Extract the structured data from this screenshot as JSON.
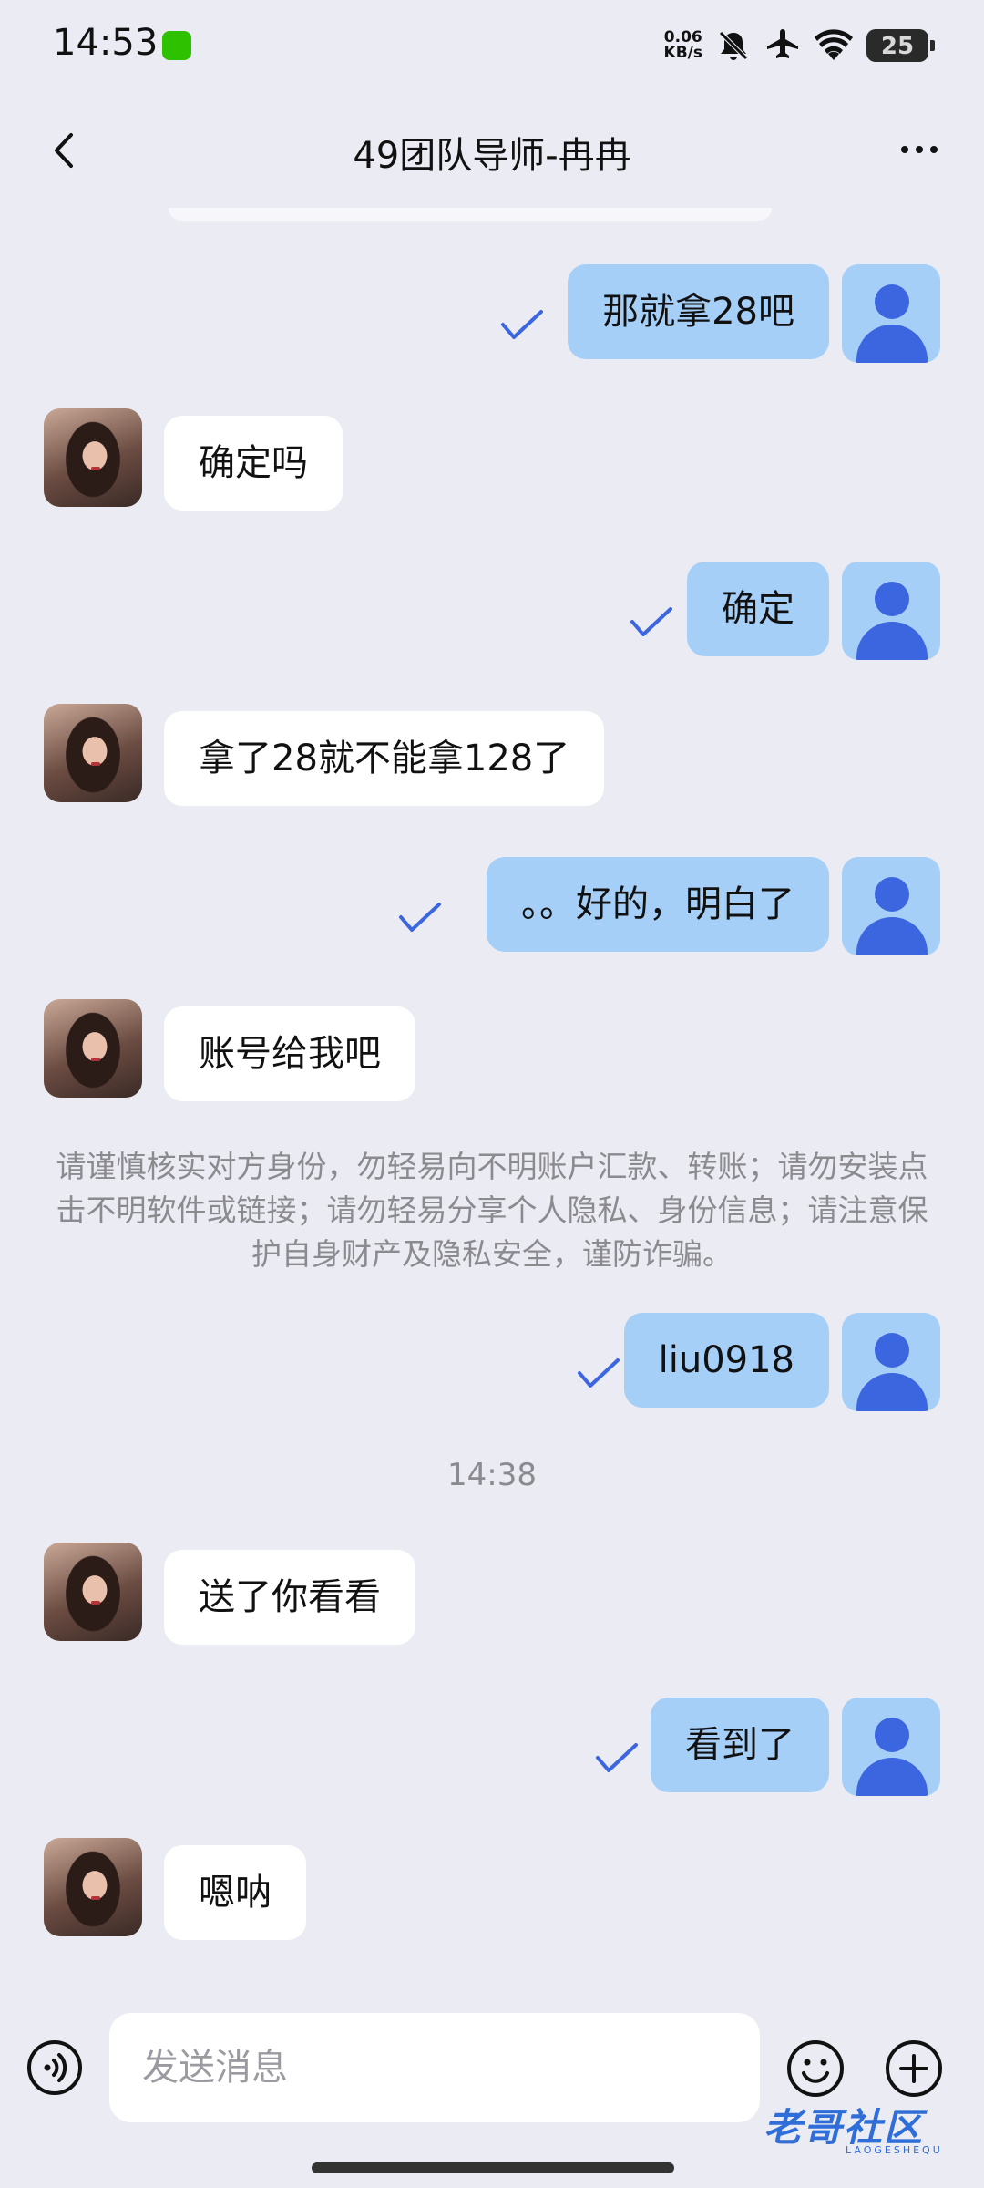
{
  "status": {
    "time": "14:53",
    "net_speed_top": "0.06",
    "net_speed_bottom": "KB/s",
    "battery": "25"
  },
  "header": {
    "title": "49团队导师-冉冉"
  },
  "messages": [
    {
      "from": "me",
      "text": "那就拿28吧",
      "read": true
    },
    {
      "from": "her",
      "text": "确定吗"
    },
    {
      "from": "me",
      "text": "确定",
      "read": true
    },
    {
      "from": "her",
      "text": "拿了28就不能拿128了"
    },
    {
      "from": "me",
      "text": "。。好的，明白了",
      "read": true
    },
    {
      "from": "her",
      "text": "账号给我吧"
    },
    {
      "from": "me",
      "text": "liu0918",
      "read": true
    },
    {
      "from": "her",
      "text": "送了你看看"
    },
    {
      "from": "me",
      "text": "看到了",
      "read": true
    },
    {
      "from": "her",
      "text": "嗯呐"
    }
  ],
  "safety_notice": "请谨慎核实对方身份，勿轻易向不明账户汇款、转账；请勿安装点击不明软件或链接；请勿轻易分享个人隐私、身份信息；请注意保护自身财产及隐私安全，谨防诈骗。",
  "timestamp": "14:38",
  "input": {
    "placeholder": "发送消息"
  },
  "watermark": {
    "text": "老哥社区",
    "sub": "LAOGESHEQU"
  },
  "icons": {
    "back": "chevron-left-icon",
    "more": "more-horizontal-icon",
    "voice": "voice-icon",
    "emoji": "emoji-icon",
    "plus": "plus-circle-icon",
    "read": "check-icon"
  },
  "colors": {
    "background": "#ebebf3",
    "outgoing_bubble": "#a6cff8",
    "incoming_bubble": "#ffffff",
    "accent": "#3b66e0"
  }
}
